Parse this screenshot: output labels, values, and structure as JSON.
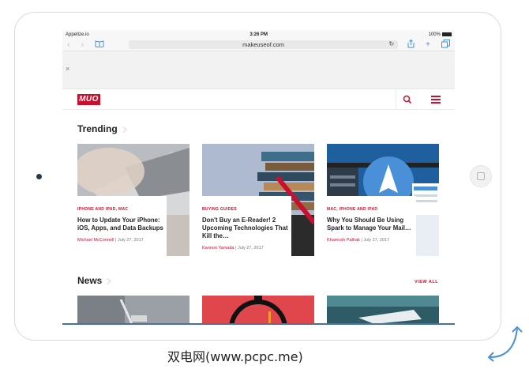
{
  "status_bar": {
    "carrier": "Appetize.io",
    "time": "3:26 PM",
    "battery": "100%"
  },
  "browser": {
    "url": "makeuseof.com",
    "nav_back_icon": "chevron-left-icon",
    "nav_forward_icon": "chevron-right-icon"
  },
  "banner": {
    "close": "×"
  },
  "site": {
    "logo": "MUO"
  },
  "trending": {
    "title": "Trending",
    "cards": [
      {
        "category": "IPHONE AND IPAD, MAC",
        "title": "How to Update Your iPhone: iOS, Apps, and Data Backups",
        "author": "Michael McConnell",
        "date": "July 27, 2017"
      },
      {
        "category": "BUYING GUIDES",
        "title": "Don't Buy an E-Reader! 2 Upcoming Technologies That Kill the…",
        "author": "Kannon Yamada",
        "date": "July 27, 2017"
      },
      {
        "category": "MAC, IPHONE AND IPAD",
        "title": "Why You Should Be Using Spark to Manage Your Mail…",
        "author": "Khamosh Pathak",
        "date": "July 27, 2017"
      }
    ]
  },
  "news": {
    "title": "News",
    "view_all": "VIEW ALL"
  },
  "watermark": "双电网(www.pcpc.me)",
  "colors": {
    "brand": "#c8102e",
    "accent": "#4a90d9"
  }
}
